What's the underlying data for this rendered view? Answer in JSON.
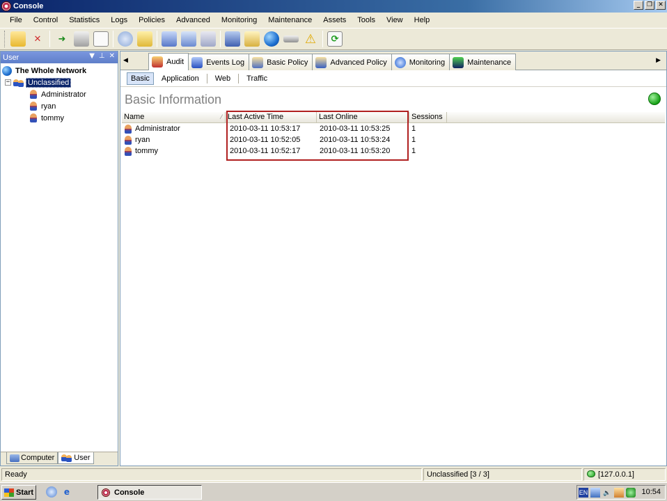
{
  "window": {
    "title": "Console"
  },
  "menu": [
    "File",
    "Control",
    "Statistics",
    "Logs",
    "Policies",
    "Advanced",
    "Monitoring",
    "Maintenance",
    "Assets",
    "Tools",
    "View",
    "Help"
  ],
  "toolbar": {
    "icons": [
      "new-folder-icon",
      "delete-icon",
      "import-icon",
      "print-icon",
      "print-preview-icon",
      "hand-icon",
      "note-icon",
      "copy-icon",
      "search-icon",
      "properties-icon",
      "computer-icon",
      "report-icon",
      "globe-icon",
      "drive-icon",
      "warning-icon",
      "refresh-icon"
    ]
  },
  "left_panel": {
    "title": "User",
    "root": "The Whole Network",
    "group": "Unclassified",
    "users": [
      "Administrator",
      "ryan",
      "tommy"
    ],
    "tabs": [
      "Computer",
      "User"
    ]
  },
  "tabs": [
    "Audit",
    "Events Log",
    "Basic Policy",
    "Advanced Policy",
    "Monitoring",
    "Maintenance"
  ],
  "subtabs": [
    "Basic",
    "Application",
    "Web",
    "Traffic"
  ],
  "section": {
    "title": "Basic Information"
  },
  "table": {
    "columns": [
      "Name",
      "Last Active Time",
      "Last Online",
      "Sessions"
    ],
    "rows": [
      {
        "name": "Administrator",
        "last_active": "2010-03-11 10:53:17",
        "last_online": "2010-03-11 10:53:25",
        "sessions": "1"
      },
      {
        "name": "ryan",
        "last_active": "2010-03-11 10:52:05",
        "last_online": "2010-03-11 10:53:24",
        "sessions": "1"
      },
      {
        "name": "tommy",
        "last_active": "2010-03-11 10:52:17",
        "last_online": "2010-03-11 10:53:20",
        "sessions": "1"
      }
    ]
  },
  "status": {
    "left": "Ready",
    "middle": "Unclassified [3 / 3]",
    "right": "[127.0.0.1]"
  },
  "taskbar": {
    "start": "Start",
    "task": "Console",
    "clock": "10:54",
    "lang": "EN"
  },
  "colors": {
    "titlebar": "#0a246a",
    "highlight": "#b02020",
    "selection": "#0a246a"
  }
}
